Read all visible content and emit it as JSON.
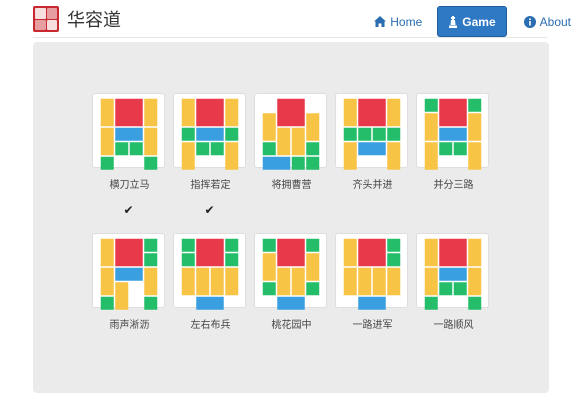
{
  "brand": {
    "title": "华容道",
    "logo": "red-seal-logo"
  },
  "nav": {
    "items": [
      {
        "label": "Home",
        "icon": "home-icon",
        "active": false
      },
      {
        "label": "Game",
        "icon": "chess-piece-icon",
        "active": true
      },
      {
        "label": "About",
        "icon": "info-icon",
        "active": false
      }
    ]
  },
  "colors": {
    "caocao": "#e8394b",
    "vertical": "#f8c446",
    "horizontal": "#3a9fe0",
    "soldier": "#24bd6a",
    "accent": "#2f78c4"
  },
  "puzzles": [
    {
      "name": "横刀立马",
      "solved": true,
      "pieces": [
        {
          "t": "v",
          "c": 0,
          "r": 0
        },
        {
          "t": "C",
          "c": 1,
          "r": 0
        },
        {
          "t": "v",
          "c": 3,
          "r": 0
        },
        {
          "t": "h",
          "c": 1,
          "r": 2
        },
        {
          "t": "v",
          "c": 0,
          "r": 2
        },
        {
          "t": "s",
          "c": 1,
          "r": 3
        },
        {
          "t": "s",
          "c": 2,
          "r": 3
        },
        {
          "t": "v",
          "c": 3,
          "r": 2
        },
        {
          "t": "s",
          "c": 0,
          "r": 4
        },
        {
          "t": "s",
          "c": 3,
          "r": 4
        }
      ]
    },
    {
      "name": "指挥若定",
      "solved": true,
      "pieces": [
        {
          "t": "v",
          "c": 0,
          "r": 0
        },
        {
          "t": "C",
          "c": 1,
          "r": 0
        },
        {
          "t": "v",
          "c": 3,
          "r": 0
        },
        {
          "t": "s",
          "c": 0,
          "r": 2
        },
        {
          "t": "h",
          "c": 1,
          "r": 2
        },
        {
          "t": "s",
          "c": 3,
          "r": 2
        },
        {
          "t": "v",
          "c": 0,
          "r": 3
        },
        {
          "t": "s",
          "c": 1,
          "r": 3
        },
        {
          "t": "s",
          "c": 2,
          "r": 3
        },
        {
          "t": "v",
          "c": 3,
          "r": 3
        }
      ]
    },
    {
      "name": "将拥曹营",
      "solved": false,
      "pieces": [
        {
          "t": "C",
          "c": 1,
          "r": 0
        },
        {
          "t": "v",
          "c": 0,
          "r": 1
        },
        {
          "t": "v",
          "c": 3,
          "r": 1
        },
        {
          "t": "v",
          "c": 1,
          "r": 2
        },
        {
          "t": "v",
          "c": 2,
          "r": 2
        },
        {
          "t": "s",
          "c": 0,
          "r": 3
        },
        {
          "t": "s",
          "c": 3,
          "r": 3
        },
        {
          "t": "h",
          "c": 0,
          "r": 4
        },
        {
          "t": "s",
          "c": 2,
          "r": 4
        },
        {
          "t": "s",
          "c": 3,
          "r": 4
        }
      ]
    },
    {
      "name": "齐头并进",
      "solved": false,
      "pieces": [
        {
          "t": "v",
          "c": 0,
          "r": 0
        },
        {
          "t": "C",
          "c": 1,
          "r": 0
        },
        {
          "t": "v",
          "c": 3,
          "r": 0
        },
        {
          "t": "s",
          "c": 0,
          "r": 2
        },
        {
          "t": "s",
          "c": 1,
          "r": 2
        },
        {
          "t": "s",
          "c": 2,
          "r": 2
        },
        {
          "t": "s",
          "c": 3,
          "r": 2
        },
        {
          "t": "v",
          "c": 0,
          "r": 3
        },
        {
          "t": "h",
          "c": 1,
          "r": 3
        },
        {
          "t": "v",
          "c": 3,
          "r": 3
        }
      ]
    },
    {
      "name": "并分三路",
      "solved": false,
      "pieces": [
        {
          "t": "s",
          "c": 0,
          "r": 0
        },
        {
          "t": "C",
          "c": 1,
          "r": 0
        },
        {
          "t": "s",
          "c": 3,
          "r": 0
        },
        {
          "t": "v",
          "c": 0,
          "r": 1
        },
        {
          "t": "v",
          "c": 3,
          "r": 1
        },
        {
          "t": "h",
          "c": 1,
          "r": 2
        },
        {
          "t": "v",
          "c": 0,
          "r": 3
        },
        {
          "t": "s",
          "c": 1,
          "r": 3
        },
        {
          "t": "s",
          "c": 2,
          "r": 3
        },
        {
          "t": "v",
          "c": 3,
          "r": 3
        }
      ]
    },
    {
      "name": "雨声淅沥",
      "solved": false,
      "pieces": [
        {
          "t": "v",
          "c": 0,
          "r": 0
        },
        {
          "t": "C",
          "c": 1,
          "r": 0
        },
        {
          "t": "s",
          "c": 3,
          "r": 0
        },
        {
          "t": "s",
          "c": 3,
          "r": 1
        },
        {
          "t": "h",
          "c": 1,
          "r": 2
        },
        {
          "t": "v",
          "c": 3,
          "r": 2
        },
        {
          "t": "v",
          "c": 0,
          "r": 2
        },
        {
          "t": "v",
          "c": 1,
          "r": 3
        },
        {
          "t": "s",
          "c": 0,
          "r": 4
        },
        {
          "t": "s",
          "c": 3,
          "r": 4
        }
      ]
    },
    {
      "name": "左右布兵",
      "solved": false,
      "pieces": [
        {
          "t": "s",
          "c": 0,
          "r": 0
        },
        {
          "t": "C",
          "c": 1,
          "r": 0
        },
        {
          "t": "s",
          "c": 3,
          "r": 0
        },
        {
          "t": "s",
          "c": 0,
          "r": 1
        },
        {
          "t": "s",
          "c": 3,
          "r": 1
        },
        {
          "t": "v",
          "c": 0,
          "r": 2
        },
        {
          "t": "v",
          "c": 1,
          "r": 2
        },
        {
          "t": "v",
          "c": 2,
          "r": 2
        },
        {
          "t": "v",
          "c": 3,
          "r": 2
        },
        {
          "t": "h",
          "c": 1,
          "r": 4
        }
      ]
    },
    {
      "name": "桃花园中",
      "solved": false,
      "pieces": [
        {
          "t": "s",
          "c": 0,
          "r": 0
        },
        {
          "t": "C",
          "c": 1,
          "r": 0
        },
        {
          "t": "s",
          "c": 3,
          "r": 0
        },
        {
          "t": "v",
          "c": 0,
          "r": 1
        },
        {
          "t": "v",
          "c": 3,
          "r": 1
        },
        {
          "t": "v",
          "c": 1,
          "r": 2
        },
        {
          "t": "v",
          "c": 2,
          "r": 2
        },
        {
          "t": "s",
          "c": 0,
          "r": 3
        },
        {
          "t": "s",
          "c": 3,
          "r": 3
        },
        {
          "t": "h",
          "c": 1,
          "r": 4
        }
      ]
    },
    {
      "name": "一路进军",
      "solved": false,
      "pieces": [
        {
          "t": "v",
          "c": 0,
          "r": 0
        },
        {
          "t": "C",
          "c": 1,
          "r": 0
        },
        {
          "t": "s",
          "c": 3,
          "r": 0
        },
        {
          "t": "s",
          "c": 3,
          "r": 1
        },
        {
          "t": "v",
          "c": 0,
          "r": 2
        },
        {
          "t": "v",
          "c": 1,
          "r": 2
        },
        {
          "t": "v",
          "c": 2,
          "r": 2
        },
        {
          "t": "v",
          "c": 3,
          "r": 2
        },
        {
          "t": "h",
          "c": 1,
          "r": 4
        }
      ]
    },
    {
      "name": "一路顺风",
      "solved": false,
      "pieces": [
        {
          "t": "v",
          "c": 0,
          "r": 0
        },
        {
          "t": "C",
          "c": 1,
          "r": 0
        },
        {
          "t": "v",
          "c": 3,
          "r": 0
        },
        {
          "t": "h",
          "c": 1,
          "r": 2
        },
        {
          "t": "v",
          "c": 0,
          "r": 2
        },
        {
          "t": "s",
          "c": 1,
          "r": 3
        },
        {
          "t": "v",
          "c": 3,
          "r": 2
        },
        {
          "t": "s",
          "c": 2,
          "r": 3
        },
        {
          "t": "s",
          "c": 0,
          "r": 4
        },
        {
          "t": "s",
          "c": 3,
          "r": 4
        }
      ]
    }
  ]
}
